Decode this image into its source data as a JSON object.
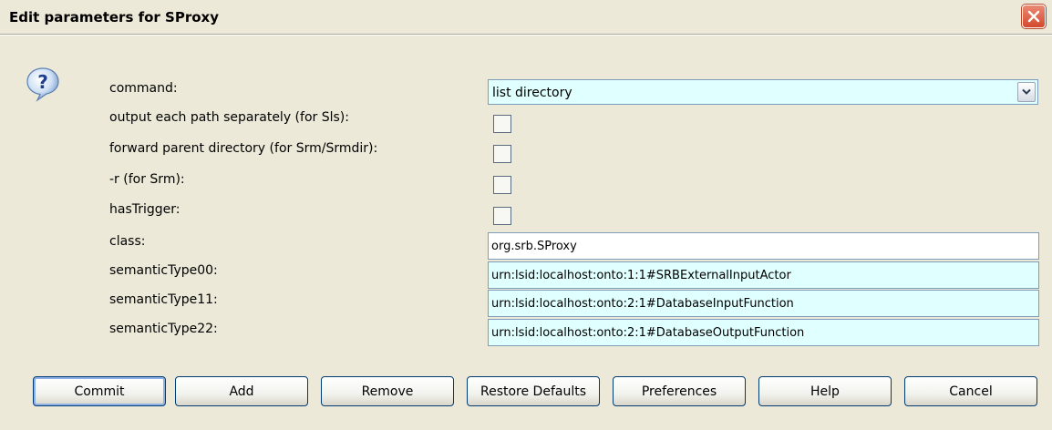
{
  "dialog": {
    "title": "Edit parameters for SProxy",
    "close_icon": "close-icon",
    "question_icon": "question-icon"
  },
  "params": [
    {
      "label": "command:",
      "type": "select",
      "value": "list directory"
    },
    {
      "label": "output each path separately (for Sls):",
      "type": "checkbox",
      "checked": false
    },
    {
      "label": "forward parent directory (for Srm/Srmdir):",
      "type": "checkbox",
      "checked": false
    },
    {
      "label": "-r (for Srm):",
      "type": "checkbox",
      "checked": false
    },
    {
      "label": "hasTrigger:",
      "type": "checkbox",
      "checked": false
    },
    {
      "label": "class:",
      "type": "text",
      "value": "org.srb.SProxy"
    },
    {
      "label": "semanticType00:",
      "type": "text",
      "value": "urn:lsid:localhost:onto:1:1#SRBExternalInputActor"
    },
    {
      "label": "semanticType11:",
      "type": "text",
      "value": "urn:lsid:localhost:onto:2:1#DatabaseInputFunction"
    },
    {
      "label": "semanticType22:",
      "type": "text",
      "value": "urn:lsid:localhost:onto:2:1#DatabaseOutputFunction"
    }
  ],
  "buttons": {
    "commit": "Commit",
    "add": "Add",
    "remove": "Remove",
    "restore": "Restore Defaults",
    "preferences": "Preferences",
    "help": "Help",
    "cancel": "Cancel"
  },
  "colors": {
    "dialog_bg": "#ece9d8",
    "field_highlight": "#e0ffff",
    "close_red": "#d3492e"
  }
}
